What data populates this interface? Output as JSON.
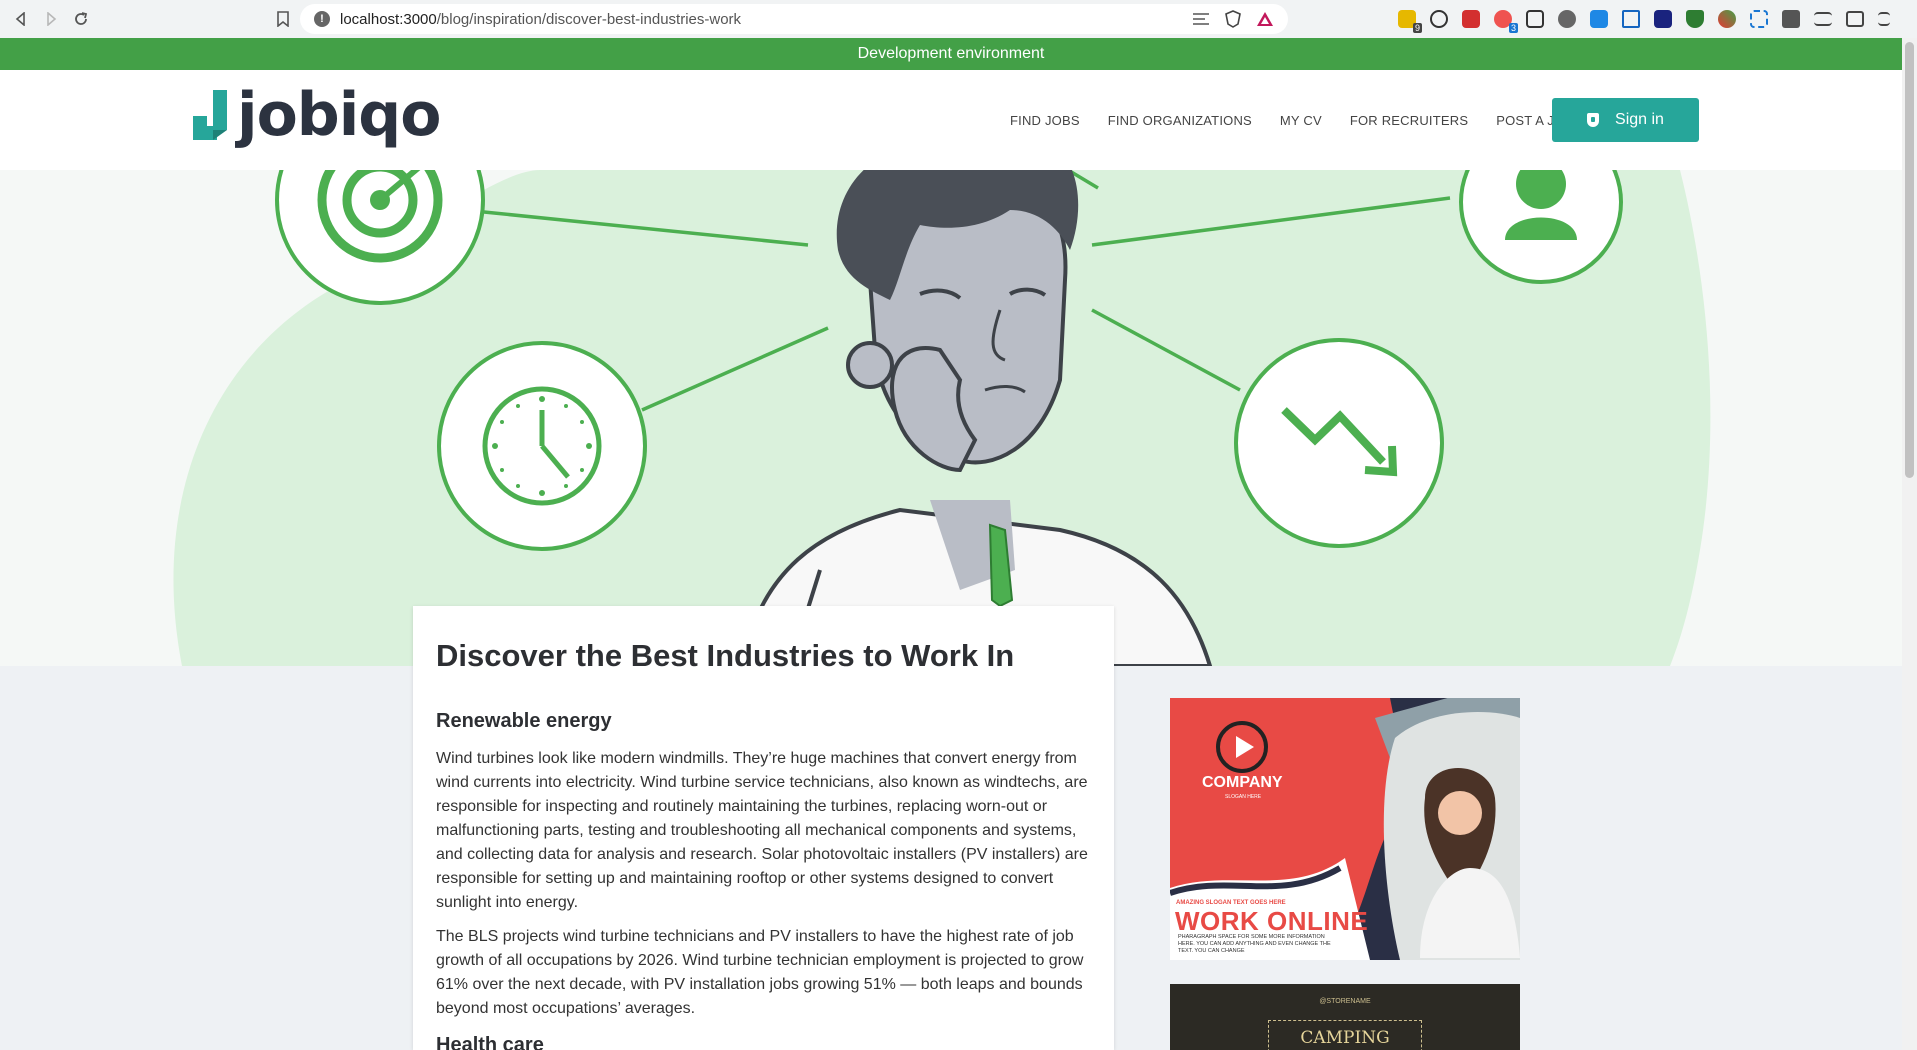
{
  "browser": {
    "url_host": "localhost:3000",
    "url_path": "/blog/inspiration/discover-best-industries-work",
    "extension_badges": [
      "9",
      "3"
    ]
  },
  "dev_banner": "Development environment",
  "header": {
    "logo_text": "jobiqo",
    "nav": [
      "FIND JOBS",
      "FIND ORGANIZATIONS",
      "MY CV",
      "FOR RECRUITERS",
      "POST A JOB"
    ],
    "signin_label": "Sign in"
  },
  "article": {
    "title": "Discover the Best Industries to Work In",
    "section1_heading": "Renewable energy",
    "section1_p1": "Wind turbines look like modern windmills. They’re huge machines that convert energy from wind currents into electricity. Wind turbine service technicians, also known as windtechs, are responsible for inspecting and routinely maintaining the turbines, replacing worn-out or malfunctioning parts, testing and troubleshooting all mechanical components and systems, and collecting data for analysis and research. Solar photovoltaic installers (PV installers) are responsible for setting up and maintaining rooftop or other systems designed to convert sunlight into energy.",
    "section1_p2": "The BLS projects wind turbine technicians and PV installers to have the highest rate of job growth of all occupations by 2026. Wind turbine technician employment is projected to grow 61% over the next decade, with PV installation jobs growing 51% — both leaps and bounds beyond most occupations’ averages.",
    "section2_heading": "Health care"
  },
  "ads": {
    "ad1_company": "COMPANY",
    "ad1_slogan_small": "SLOGAN HERE",
    "ad1_tagline": "AMAZING SLOGAN TEXT GOES HERE",
    "ad1_headline": "WORK ONLINE",
    "ad1_body": "PHARAGRAPH SPACE FOR SOME MORE INFORMATION HERE. YOU CAN ADD ANYTHING AND EVEN CHANGE THE TEXT. YOU CAN CHANGE",
    "ad2_store": "@STORENAME",
    "ad2_headline": "CAMPING"
  },
  "colors": {
    "brand_teal": "#26a69a",
    "dev_green": "#43a047",
    "hero_green": "#4caf50",
    "ad_red": "#e84a45"
  }
}
